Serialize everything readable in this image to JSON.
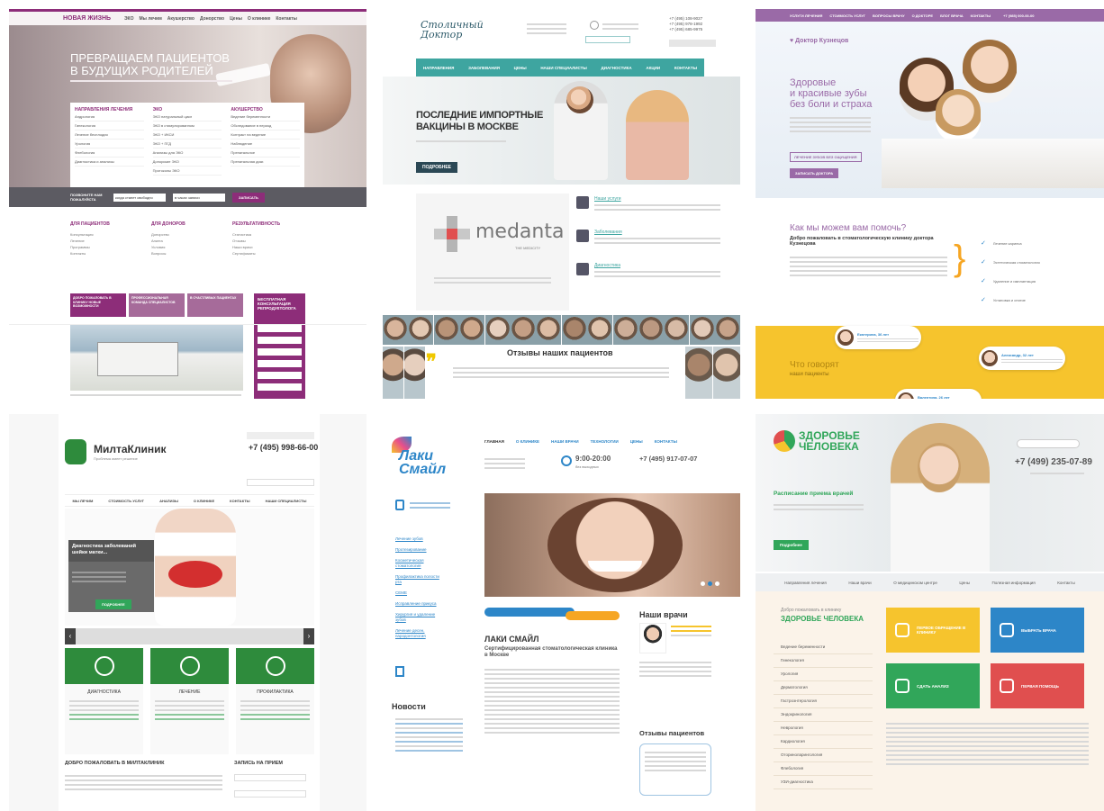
{
  "colors": {
    "purple": "#8d2d79",
    "teal": "#3ea5a0",
    "violet": "#9a6aa7",
    "yellow": "#f6c42d",
    "green": "#31a65a",
    "blue": "#2d86c8"
  },
  "t1": {
    "logo": "НОВАЯ ЖИЗНЬ",
    "nav": [
      "ЭКО",
      "Мы лечим",
      "Акушерство",
      "Донорство",
      "Цены",
      "О клинике",
      "Контакты"
    ],
    "hero": "ПРЕВРАЩАЕМ ПАЦИЕНТОВ\nВ БУДУЩИХ РОДИТЕЛЕЙ",
    "col1": {
      "title": "НАПРАВЛЕНИЯ ЛЕЧЕНИЯ",
      "items": [
        "Андрология",
        "Гинекология",
        "Лечение бесплодия",
        "Урология",
        "Флебология",
        "Диагностика и анализы"
      ]
    },
    "col2": {
      "title": "ЭКО",
      "items": [
        "ЭКО натуральный цикл",
        "ЭКО в стимулированном",
        "ЭКО + ИКСИ",
        "ЭКО + ПГД",
        "Анализы для ЭКО",
        "Донорские ЭКО",
        "Протоколы ЭКО"
      ]
    },
    "col3": {
      "title": "АКУШЕРСТВО",
      "items": [
        "Ведение беременности",
        "Обследование в период",
        "Контракт на ведение",
        "Наблюдение",
        "Пренатальное",
        "Пренатальная диаг."
      ]
    },
    "call": "ПОЗВОНИТЕ НАМ ПОЖАЛУЙСТА",
    "select1": "когда станет свободно",
    "select2": "в часах записи",
    "send": "ЗАПИСАТЬ",
    "sections": [
      {
        "title": "ДЛЯ ПАЦИЕНТОВ",
        "items": [
          "Консультация",
          "Лечение",
          "Программы",
          "Контакты"
        ]
      },
      {
        "title": "ДЛЯ ДОНОРОВ",
        "items": [
          "Донорство",
          "Анкета",
          "Условия",
          "Вопросы"
        ]
      },
      {
        "title": "РЕЗУЛЬТАТИВНОСТЬ",
        "items": [
          "Статистика",
          "Отзывы",
          "Наши врачи",
          "Сертификаты"
        ]
      }
    ],
    "tabs": [
      "ДОБРО ПОЖАЛОВАТЬ В КЛИНИКУ НОВЫЕ ВОЗМОЖНОСТИ",
      "ПРОФЕССИОНАЛЬНАЯ КОМАНДА СПЕЦИАЛИСТОВ",
      "В СЧАСТЛИВЫХ ПАЦИЕНТАХ"
    ],
    "consult": "БЕСПЛАТНАЯ КОНСУЛЬТАЦИЯ РЕПРОДУКТОЛОГА"
  },
  "t2": {
    "logo": "Столичный Доктор",
    "nav": [
      "НАПРАВЛЕНИЯ",
      "ЗАБОЛЕВАНИЯ",
      "ЦЕНЫ",
      "НАШИ СПЕЦИАЛИСТЫ",
      "ДИАГНОСТИКА",
      "АКЦИИ",
      "КОНТАКТЫ"
    ],
    "phones": [
      "+7 (495) 108-9027",
      "+7 (495) 978-1992",
      "+7 (495) 685-9975"
    ],
    "hero": "ПОСЛЕДНИЕ ИМПОРТНЫЕ\nВАКЦИНЫ В МОСКВЕ",
    "hero_btn": "ПОДРОБНЕЕ",
    "brand": "medanta",
    "brand_sub": "THE MEDICITY",
    "services": [
      {
        "title": "Наши услуги"
      },
      {
        "title": "Заболевания"
      },
      {
        "title": "Диагностика"
      }
    ],
    "reviews": "Отзывы наших пациентов"
  },
  "t3": {
    "nav": [
      "УСЛУГИ ЛЕЧЕНИЯ",
      "СТОИМОСТЬ УСЛУГ",
      "ВОПРОСЫ ВРАЧУ",
      "О ДОКТОРЕ",
      "БЛОГ ВРАЧА",
      "КОНТАКТЫ"
    ],
    "phone": "+7 (985) 000-00-00",
    "brand": "Доктор Кузнецов",
    "hero": "Здоровые\nи красивые зубы\nбез боли и страха",
    "btn1": "ЛЕЧЕНИЕ ЗУБОВ БЕЗ ОЩУЩЕНИЯ",
    "btn2": "ЗАПИСАТЬ ДОКТОРА",
    "help": "Как мы можем вам помочь?",
    "welcome": "Добро пожаловать в стоматологическую клинику доктора Кузнецова",
    "checks": [
      "Лечение кариеса",
      "Эстетическая стоматология",
      "Удаление и имплантация",
      "Установка и снятие"
    ],
    "reviewers": [
      "Екатерина, 36 лет",
      "Александр, 32 лет",
      "Валентина, 26 лет"
    ],
    "reviews_title": "Что говорят",
    "reviews_sub": "наши пациенты"
  },
  "t4": {
    "logo": "МилтаКлиник",
    "slogan": "Проблема имеет решение",
    "phone": "+7 (495) 998-66-00",
    "nav": [
      "МЫ ЛЕЧИМ",
      "СТОИМОСТЬ УСЛУГ",
      "АНАЛИЗЫ",
      "О КЛИНИКЕ",
      "КОНТАКТЫ",
      "НАШИ СПЕЦИАЛИСТЫ"
    ],
    "promo": "Диагностика заболеваний шейки матки...",
    "promo_btn": "ПОДРОБНЕЕ",
    "cards": [
      "ДИАГНОСТИКА",
      "ЛЕЧЕНИЕ",
      "ПРОФИЛАКТИКА"
    ],
    "welcome": "ДОБРО ПОЖАЛОВАТЬ В МИЛТАКЛИНИК",
    "appointment": "ЗАПИСЬ НА ПРИЕМ"
  },
  "t5": {
    "logo": "Лаки Смайл",
    "nav": [
      "ГЛАВНАЯ",
      "О КЛИНИКЕ",
      "НАШИ ВРАЧИ",
      "ТЕХНОЛОГИИ",
      "ЦЕНЫ",
      "КОНТАКТЫ"
    ],
    "hours": "9:00-20:00",
    "hours_sub": "без выходных",
    "phone": "+7 (495) 917-07-07",
    "side": [
      "Лечение зубов",
      "Протезирование",
      "Косметическая стоматология",
      "Профилактика полости рта",
      "СЕМЕ",
      "Исправление прикуса",
      "Хирургия и удаление зубов",
      "Лечение десен, пародонтология"
    ],
    "news": "Новости",
    "title": "ЛАКИ СМАЙЛ",
    "subtitle": "Сертифицированная стоматологическая клиника в Москве",
    "doctors": "Наши врачи",
    "reviews": "Отзывы пациентов"
  },
  "t6": {
    "logo_top": "ЗДОРОВЬЕ",
    "logo_bottom": "ЧЕЛОВЕКА",
    "phone": "+7 (499) 235-07-89",
    "schedule": "Расписание приема врачей",
    "btn": "Подробнее",
    "nav": [
      "Направления лечения",
      "Наши врачи",
      "О медицинском центре",
      "Цены",
      "Полезная информация",
      "Контакты"
    ],
    "welcome_top": "Добро пожаловать в клинику",
    "welcome": "ЗДОРОВЬЕ ЧЕЛОВЕКА",
    "list": [
      "Ведение беременности",
      "Гинекология",
      "Урология",
      "Дерматология",
      "Гастроэнтерология",
      "Эндокринология",
      "Неврология",
      "Кардиология",
      "Оториноларингология",
      "Флебология",
      "УЗИ-диагностика"
    ],
    "tiles": [
      "ПЕРВОЕ ОБРАЩЕНИЕ В КЛИНИКУ",
      "ВЫБРАТЬ ВРАЧА",
      "СДАТЬ АНАЛИЗ",
      "ПЕРВАЯ ПОМОЩЬ"
    ]
  }
}
